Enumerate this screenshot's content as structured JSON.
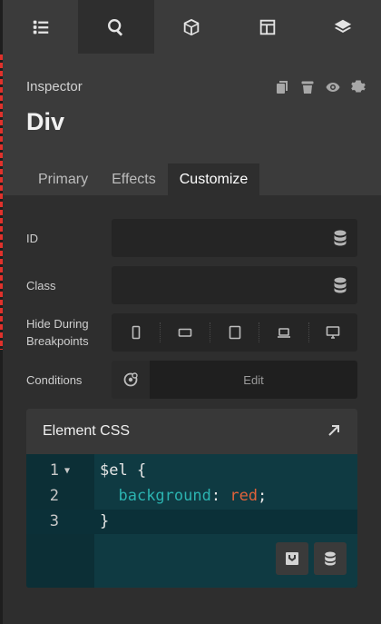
{
  "topbar": {
    "tabs": [
      {
        "icon": "list-icon",
        "active": false
      },
      {
        "icon": "search-icon",
        "active": true
      },
      {
        "icon": "cube-icon",
        "active": false
      },
      {
        "icon": "layout-icon",
        "active": false
      },
      {
        "icon": "layers-icon",
        "active": false
      }
    ]
  },
  "header": {
    "inspector_label": "Inspector",
    "element_title": "Div",
    "icons": [
      "copy-icon",
      "trash-icon",
      "eye-icon",
      "gear-icon"
    ],
    "tabs": [
      {
        "label": "Primary",
        "active": false
      },
      {
        "label": "Effects",
        "active": false
      },
      {
        "label": "Customize",
        "active": true
      }
    ]
  },
  "form": {
    "id_label": "ID",
    "id_value": "",
    "class_label": "Class",
    "class_value": "",
    "hide_label_line1": "Hide During",
    "hide_label_line2": "Breakpoints",
    "breakpoints": [
      "phone-icon",
      "phone-landscape-icon",
      "tablet-icon",
      "laptop-icon",
      "desktop-icon"
    ],
    "conditions_label": "Conditions",
    "edit_label": "Edit"
  },
  "element_css": {
    "title": "Element CSS",
    "lines": [
      {
        "num": "1",
        "fold": "▼",
        "parts": [
          {
            "t": "$el {",
            "c": "plain"
          }
        ]
      },
      {
        "num": "2",
        "fold": "",
        "parts": [
          {
            "t": "  ",
            "c": "plain"
          },
          {
            "t": "background",
            "c": "prop"
          },
          {
            "t": ": ",
            "c": "plain"
          },
          {
            "t": "red",
            "c": "val"
          },
          {
            "t": ";",
            "c": "plain"
          }
        ]
      },
      {
        "num": "3",
        "fold": "",
        "parts": [
          {
            "t": "}",
            "c": "plain"
          }
        ]
      }
    ]
  },
  "colors": {
    "accent_dashed": "#e0312b",
    "code_bg": "#0f3a42",
    "property": "#2bb3b0",
    "value": "#e0623a"
  }
}
